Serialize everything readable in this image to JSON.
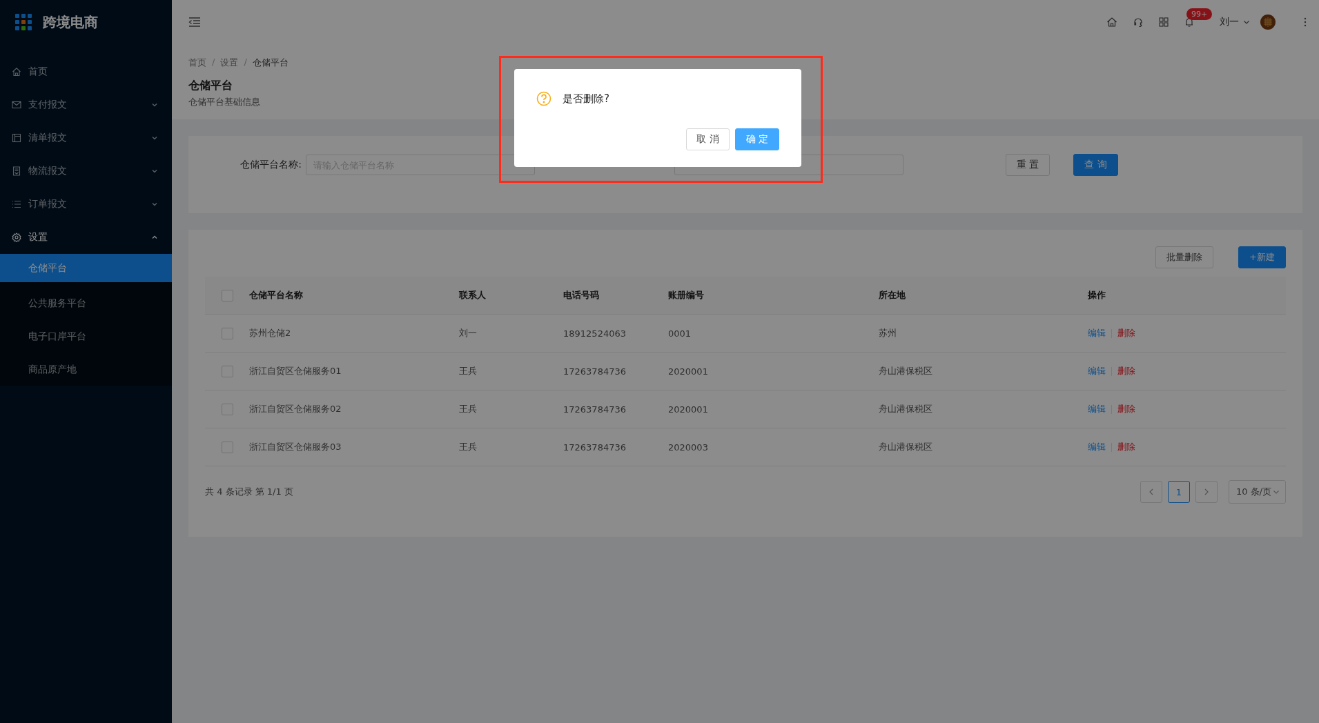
{
  "app": {
    "title": "跨境电商"
  },
  "sidebar": {
    "items": [
      {
        "label": "首页",
        "kind": "link"
      },
      {
        "label": "支付报文",
        "kind": "group",
        "expanded": false
      },
      {
        "label": "清单报文",
        "kind": "group",
        "expanded": false
      },
      {
        "label": "物流报文",
        "kind": "group",
        "expanded": false
      },
      {
        "label": "订单报文",
        "kind": "group",
        "expanded": false
      },
      {
        "label": "设置",
        "kind": "group",
        "expanded": true,
        "children": [
          {
            "label": "仓储平台",
            "selected": true
          },
          {
            "label": "公共服务平台",
            "selected": false
          },
          {
            "label": "电子口岸平台",
            "selected": false
          },
          {
            "label": "商品原产地",
            "selected": false
          }
        ]
      }
    ]
  },
  "header": {
    "notification_badge": "99+",
    "user_name": "刘一"
  },
  "breadcrumb": [
    {
      "kind": "link",
      "label": "首页"
    },
    {
      "kind": "separator",
      "label": "/"
    },
    {
      "kind": "link",
      "label": "设置"
    },
    {
      "kind": "separator",
      "label": "/"
    },
    {
      "kind": "current",
      "label": "仓储平台"
    }
  ],
  "page": {
    "title": "仓储平台",
    "subtitle": "仓储平台基础信息"
  },
  "search_form": {
    "fields": [
      {
        "kind": "labeled",
        "label": "仓储平台名称:",
        "placeholder": "请输入仓储平台名称"
      },
      {
        "kind": "covered"
      }
    ],
    "buttons": [
      {
        "label": "重 置",
        "kind": "default"
      },
      {
        "label": "查 询",
        "kind": "primary"
      }
    ]
  },
  "toolbar": {
    "buttons": [
      {
        "label": "批量删除",
        "kind": "default"
      },
      {
        "label": "+新建",
        "kind": "primary"
      }
    ]
  },
  "table": {
    "header_checked": false,
    "columns": [
      "仓储平台名称",
      "联系人",
      "电话号码",
      "账册编号",
      "所在地",
      "操作"
    ],
    "rows": [
      {
        "checked": false,
        "cells": [
          "苏州仓储2",
          "刘一",
          "18912524063",
          "0001",
          "苏州"
        ],
        "actions": [
          "编辑",
          "删除"
        ]
      },
      {
        "checked": false,
        "cells": [
          "浙江自贸区仓储服务01",
          "王兵",
          "17263784736",
          "2020001",
          "舟山港保税区"
        ],
        "actions": [
          "编辑",
          "删除"
        ]
      },
      {
        "checked": false,
        "cells": [
          "浙江自贸区仓储服务02",
          "王兵",
          "17263784736",
          "2020001",
          "舟山港保税区"
        ],
        "actions": [
          "编辑",
          "删除"
        ]
      },
      {
        "checked": false,
        "cells": [
          "浙江自贸区仓储服务03",
          "王兵",
          "17263784736",
          "2020003",
          "舟山港保税区"
        ],
        "actions": [
          "编辑",
          "删除"
        ]
      }
    ]
  },
  "pagination": {
    "summary": "共 4 条记录 第 1/1 页",
    "pages": [
      {
        "label": "1",
        "selected": true
      }
    ],
    "page_size": "10 条/页"
  },
  "dialog": {
    "message": "是否删除?",
    "buttons": [
      {
        "label": "取 消",
        "kind": "default"
      },
      {
        "label": "确 定",
        "kind": "primary"
      }
    ],
    "highlighted": true
  }
}
